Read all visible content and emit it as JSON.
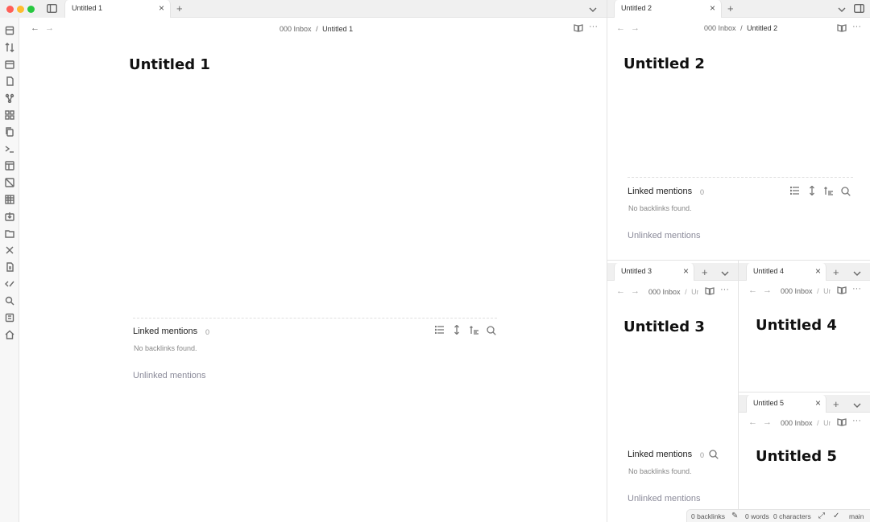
{
  "window": {
    "traffic_lights": [
      "#ff5f57",
      "#febc2e",
      "#28c840"
    ]
  },
  "ribbon": {
    "icons": [
      "file-explorer-icon",
      "sort-icon",
      "calendar-icon",
      "templates-icon",
      "graph-icon",
      "canvas-icon",
      "copy-icon",
      "terminal-icon",
      "table-icon",
      "image-icon",
      "spreadsheet-icon",
      "import-icon",
      "folder-icon",
      "tools-icon",
      "doc-icon",
      "code-icon",
      "search-icon",
      "book-icon",
      "home-icon"
    ]
  },
  "pane1": {
    "tab": "Untitled 1",
    "breadcrumb_folder": "000 Inbox",
    "breadcrumb_sep": "/",
    "breadcrumb_note": "Untitled 1",
    "title": "Untitled 1",
    "linked_mentions": "Linked mentions",
    "linked_count": "0",
    "no_backlinks": "No backlinks found.",
    "unlinked_mentions": "Unlinked mentions"
  },
  "pane2": {
    "tab": "Untitled 2",
    "breadcrumb_folder": "000 Inbox",
    "breadcrumb_sep": "/",
    "breadcrumb_note": "Untitled 2",
    "title": "Untitled 2",
    "linked_mentions": "Linked mentions",
    "linked_count": "0",
    "no_backlinks": "No backlinks found.",
    "unlinked_mentions": "Unlinked mentions"
  },
  "pane3": {
    "tab": "Untitled 3",
    "breadcrumb_folder": "000 Inbox",
    "breadcrumb_sep": "/",
    "breadcrumb_note": "Un",
    "title": "Untitled 3",
    "linked_mentions": "Linked mentions",
    "linked_count": "0",
    "no_backlinks": "No backlinks found.",
    "unlinked_mentions": "Unlinked mentions"
  },
  "pane4": {
    "tab": "Untitled 4",
    "breadcrumb_folder": "000 Inbox",
    "breadcrumb_sep": "/",
    "breadcrumb_note": "Un",
    "title": "Untitled 4"
  },
  "pane5": {
    "tab": "Untitled 5",
    "breadcrumb_folder": "000 Inbox",
    "breadcrumb_sep": "/",
    "breadcrumb_note": "Un",
    "title": "Untitled 5"
  },
  "status": {
    "backlinks": "0 backlinks",
    "words": "0 words",
    "characters": "0 characters",
    "branch": "main"
  }
}
